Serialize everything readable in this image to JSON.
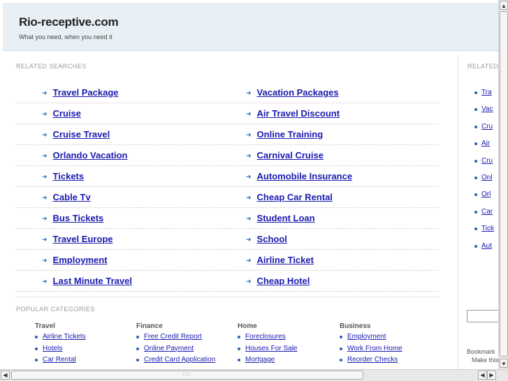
{
  "header": {
    "title": "Rio-receptive.com",
    "tagline": "What you need, when you need it"
  },
  "related": {
    "label": "RELATED SEARCHES",
    "rows": [
      [
        "Travel Package",
        "Vacation Packages"
      ],
      [
        "Cruise",
        "Air Travel Discount"
      ],
      [
        "Cruise Travel",
        "Online Training"
      ],
      [
        "Orlando Vacation",
        "Carnival Cruise"
      ],
      [
        "Tickets",
        "Automobile Insurance"
      ],
      [
        "Cable Tv",
        "Cheap Car Rental"
      ],
      [
        "Bus Tickets",
        "Student Loan"
      ],
      [
        "Travel Europe",
        "School"
      ],
      [
        "Employment",
        "Airline Ticket"
      ],
      [
        "Last Minute Travel",
        "Cheap Hotel"
      ]
    ]
  },
  "popular": {
    "label": "POPULAR CATEGORIES",
    "categories": [
      {
        "title": "Travel",
        "links": [
          "Airline Tickets",
          "Hotels",
          "Car Rental"
        ]
      },
      {
        "title": "Finance",
        "links": [
          "Free Credit Report",
          "Online Payment",
          "Credit Card Application"
        ]
      },
      {
        "title": "Home",
        "links": [
          "Foreclosures",
          "Houses For Sale",
          "Mortgage"
        ]
      },
      {
        "title": "Business",
        "links": [
          "Employment",
          "Work From Home",
          "Reorder Checks"
        ]
      }
    ]
  },
  "sidebar": {
    "label": "RELATED",
    "items": [
      "Tra",
      "Vac",
      "Cru",
      "Air",
      "Cru",
      "Onl",
      "Orl",
      "Car",
      "Tick",
      "Aut"
    ],
    "bookmark": "Bookmark",
    "make": "Make this"
  }
}
